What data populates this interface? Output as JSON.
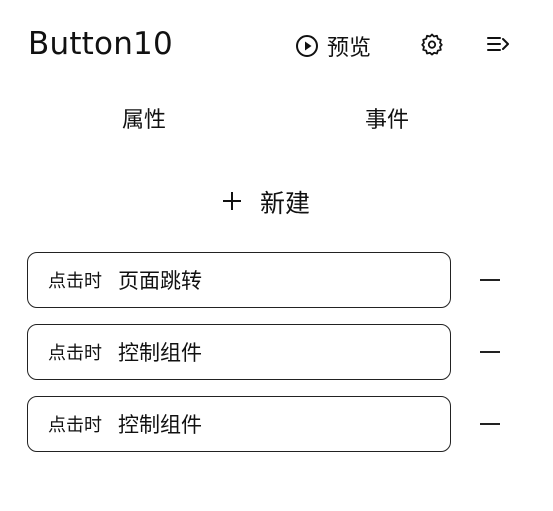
{
  "header": {
    "title": "Button10",
    "preview_label": "预览",
    "icons": [
      "play-circle-icon",
      "gear-icon",
      "collapse-menu-icon"
    ]
  },
  "tabs": [
    {
      "label": "属性"
    },
    {
      "label": "事件"
    }
  ],
  "new_button": {
    "icon": "plus-icon",
    "label": "新建"
  },
  "events": [
    {
      "trigger": "点击时",
      "action": "页面跳转"
    },
    {
      "trigger": "点击时",
      "action": "控制组件"
    },
    {
      "trigger": "点击时",
      "action": "控制组件"
    }
  ],
  "colors": {
    "text": "#111111",
    "border": "#222222",
    "background": "#ffffff"
  }
}
